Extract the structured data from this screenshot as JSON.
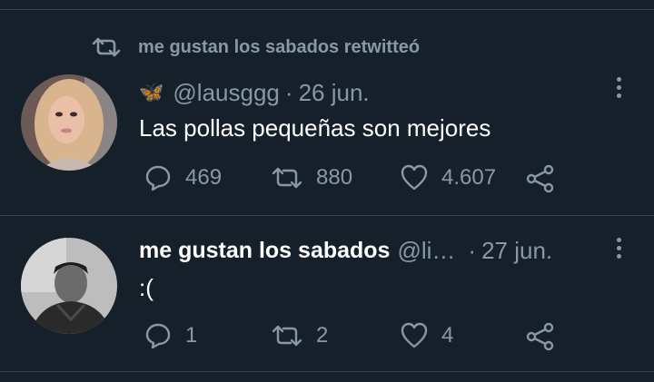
{
  "retweet_banner": {
    "text": "me gustan los sabados retwitteó"
  },
  "tweets": [
    {
      "emoji": "🦋",
      "handle": "@lausggg",
      "separator": "·",
      "date": "26 jun.",
      "text": "Las pollas pequeñas son mejores",
      "replies": "469",
      "retweets": "880",
      "likes": "4.607"
    },
    {
      "display_name": "me gustan los sabados",
      "handle": "@li…",
      "separator": "·",
      "date": "27 jun.",
      "text": ":(",
      "replies": "1",
      "retweets": "2",
      "likes": "4"
    }
  ],
  "colors": {
    "background": "#15202b",
    "muted": "#8899a6",
    "divider": "#38444d",
    "text": "#ffffff",
    "emoji_blue": "#2e8fff"
  }
}
